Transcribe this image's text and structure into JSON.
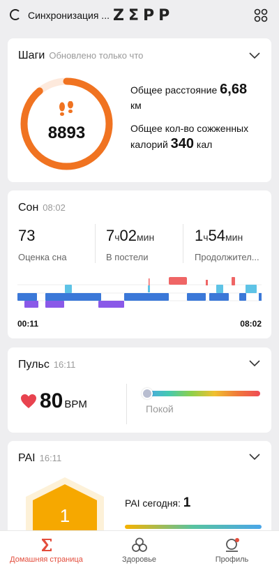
{
  "header": {
    "sync_text": "Синхронизация ...",
    "logo": "ZΣPP",
    "menu_icon": "grid-icon"
  },
  "steps": {
    "title": "Шаги",
    "updated": "Обновлено только что",
    "count": "8893",
    "goal_progress": 0.89,
    "distance_label": "Общее расстояние",
    "distance_value": "6,68",
    "distance_unit": "км",
    "calories_label_1": "Общее кол-во сожженных",
    "calories_label_2": "калорий",
    "calories_value": "340",
    "calories_unit": "кал",
    "accent": "#f07321"
  },
  "sleep": {
    "title": "Сон",
    "time": "08:02",
    "score_value": "73",
    "score_label": "Оценка сна",
    "bed_hours": "7",
    "bed_h_unit": "ч",
    "bed_minutes": "02",
    "bed_m_unit": "мин",
    "bed_label": "В постели",
    "dur_hours": "1",
    "dur_h_unit": "ч",
    "dur_minutes": "54",
    "dur_m_unit": "мин",
    "dur_label": "Продолжител...",
    "start_time": "00:11",
    "end_time": "08:02"
  },
  "pulse": {
    "title": "Пульс",
    "time": "16:11",
    "value": "80",
    "unit": "BPM",
    "zone": "Покой",
    "heart_color": "#e8434f"
  },
  "pai": {
    "title": "PAI",
    "time": "16:11",
    "value": "1",
    "today_label": "PAI сегодня:",
    "today_value": "1",
    "hex_color": "#f6a800"
  },
  "nav": {
    "home": "Домашняя страница",
    "health": "Здоровье",
    "profile": "Профиль",
    "active_color": "#e34d3c"
  }
}
